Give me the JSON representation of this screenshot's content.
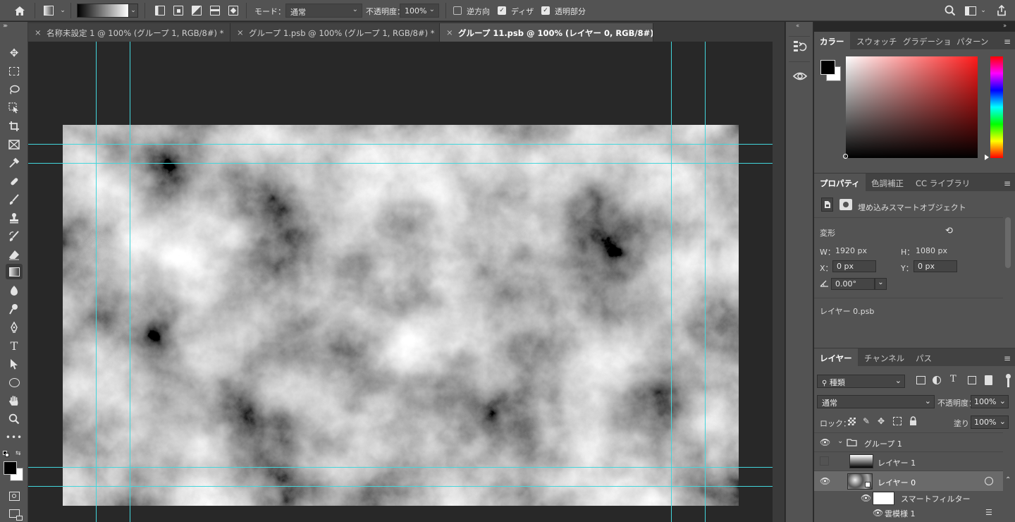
{
  "options_bar": {
    "mode_label": "モード：",
    "mode_value": "通常",
    "opacity_label": "不透明度：",
    "opacity_value": "100%",
    "reverse_label": "逆方向",
    "dither_label": "ディザ",
    "transparency_label": "透明部分",
    "reverse_checked": false,
    "dither_checked": true,
    "transparency_checked": true
  },
  "tabs": [
    {
      "label": "名称未設定 1 @ 100% (グループ 1, RGB/8#) *",
      "active": false
    },
    {
      "label": "グループ 1.psb @ 100% (グループ 1, RGB/8#) *",
      "active": false
    },
    {
      "label": "グループ 11.psb @ 100% (レイヤー 0, RGB/8#) *",
      "active": true
    }
  ],
  "color_panel": {
    "tabs": [
      "カラー",
      "スウォッチ",
      "グラデーショ",
      "パターン"
    ],
    "hue_color": "#ff1a1a"
  },
  "properties_panel": {
    "tabs": [
      "プロパティ",
      "色調補正",
      "CC ライブラリ"
    ],
    "object_type": "埋め込みスマートオブジェクト",
    "transform_label": "変形",
    "w_label": "W：",
    "w_value": "1920 px",
    "h_label": "H：",
    "h_value": "1080 px",
    "x_label": "X：",
    "x_value": "0 px",
    "y_label": "Y：",
    "y_value": "0 px",
    "angle_value": "0.00°",
    "linked_file": "レイヤー 0.psb"
  },
  "layers_panel": {
    "tabs": [
      "レイヤー",
      "チャンネル",
      "パス"
    ],
    "filter_label": "種類",
    "blend_mode": "通常",
    "opacity_label": "不透明度：",
    "opacity_value": "100%",
    "lock_label": "ロック：",
    "fill_label": "塗り：",
    "fill_value": "100%",
    "layers": {
      "group": "グループ 1",
      "layer1": "レイヤー 1",
      "layer0": "レイヤー 0",
      "smart_filter": "スマートフィルター",
      "clouds": "雲模様 1"
    }
  }
}
